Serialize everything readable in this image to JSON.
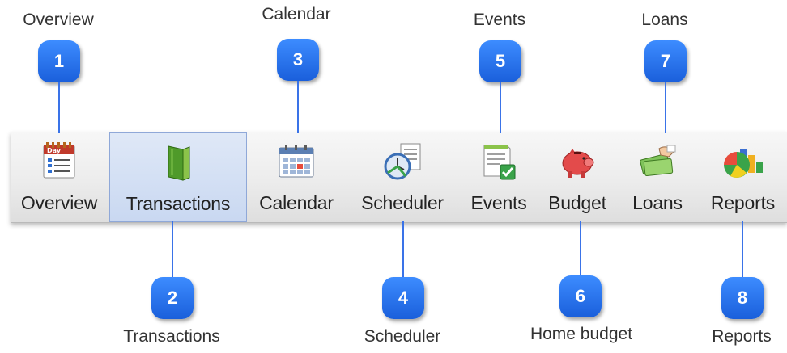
{
  "toolbar": {
    "buttons": [
      {
        "label": "Overview",
        "icon": "calendar-day-list-icon"
      },
      {
        "label": "Transactions",
        "icon": "green-book-icon"
      },
      {
        "label": "Calendar",
        "icon": "calendar-grid-icon"
      },
      {
        "label": "Scheduler",
        "icon": "clock-document-icon"
      },
      {
        "label": "Events",
        "icon": "document-checkmark-icon"
      },
      {
        "label": "Budget",
        "icon": "piggy-bank-icon"
      },
      {
        "label": "Loans",
        "icon": "hand-money-icon"
      },
      {
        "label": "Reports",
        "icon": "pie-bar-chart-icon"
      }
    ],
    "active_button": "Transactions"
  },
  "callouts": [
    {
      "number": "1",
      "caption": "Overview"
    },
    {
      "number": "2",
      "caption": "Transactions"
    },
    {
      "number": "3",
      "caption": "Calendar"
    },
    {
      "number": "4",
      "caption": "Scheduler"
    },
    {
      "number": "5",
      "caption": "Events"
    },
    {
      "number": "6",
      "caption": "Home budget"
    },
    {
      "number": "7",
      "caption": "Loans"
    },
    {
      "number": "8",
      "caption": "Reports"
    }
  ],
  "colors": {
    "marker_blue": "#2a74f0",
    "active_highlight": "#c9d8f1"
  }
}
